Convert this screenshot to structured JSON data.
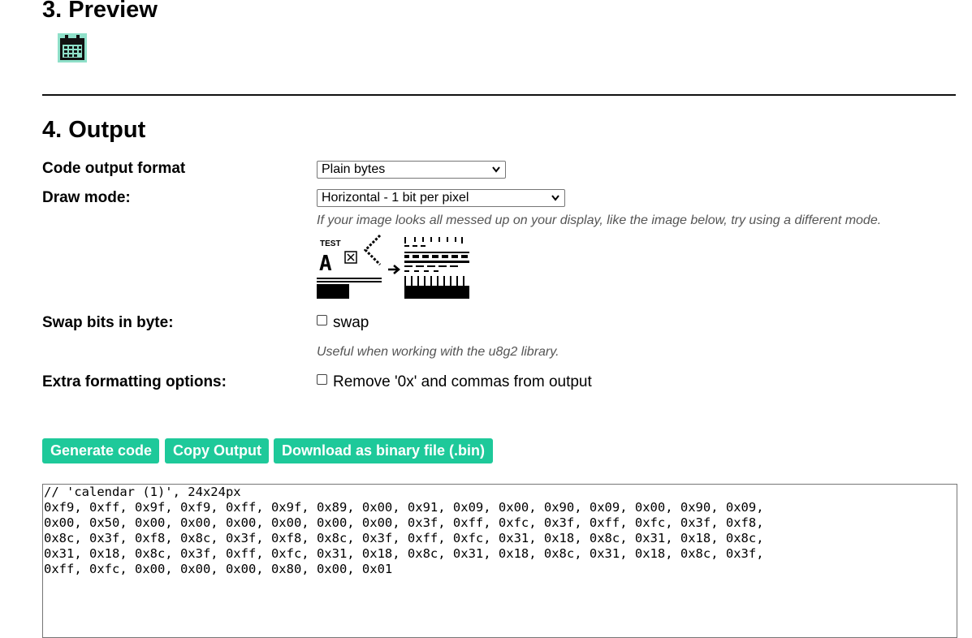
{
  "preview": {
    "heading": "3. Preview",
    "image_icon": "calendar-icon",
    "image_bg": "#8fe0c9"
  },
  "output": {
    "heading": "4. Output",
    "format_label": "Code output format",
    "format_value": "Plain bytes",
    "draw_label": "Draw mode:",
    "draw_value": "Horizontal - 1 bit per pixel",
    "draw_hint": "If your image looks all messed up on your display, like the image below, try using a different mode.",
    "demo_test_text": "TEST",
    "demo_letter": "A",
    "swap_label": "Swap bits in byte:",
    "swap_checkbox_label": "swap",
    "swap_checked": false,
    "swap_hint": "Useful when working with the u8g2 library.",
    "extra_label": "Extra formatting options:",
    "extra_checkbox_label": "Remove '0x' and commas from output",
    "extra_checked": false
  },
  "buttons": {
    "generate": "Generate code",
    "copy": "Copy Output",
    "download": "Download as binary file (.bin)"
  },
  "code_output": "// 'calendar (1)', 24x24px\n0xf9, 0xff, 0x9f, 0xf9, 0xff, 0x9f, 0x89, 0x00, 0x91, 0x09, 0x00, 0x90, 0x09, 0x00, 0x90, 0x09,\n0x00, 0x50, 0x00, 0x00, 0x00, 0x00, 0x00, 0x00, 0x3f, 0xff, 0xfc, 0x3f, 0xff, 0xfc, 0x3f, 0xf8,\n0x8c, 0x3f, 0xf8, 0x8c, 0x3f, 0xf8, 0x8c, 0x3f, 0xff, 0xfc, 0x31, 0x18, 0x8c, 0x31, 0x18, 0x8c,\n0x31, 0x18, 0x8c, 0x3f, 0xff, 0xfc, 0x31, 0x18, 0x8c, 0x31, 0x18, 0x8c, 0x31, 0x18, 0x8c, 0x3f,\n0xff, 0xfc, 0x00, 0x00, 0x00, 0x80, 0x00, 0x01",
  "colors": {
    "accent": "#1ec99a",
    "hint_text": "#555555",
    "divider": "#111111"
  }
}
